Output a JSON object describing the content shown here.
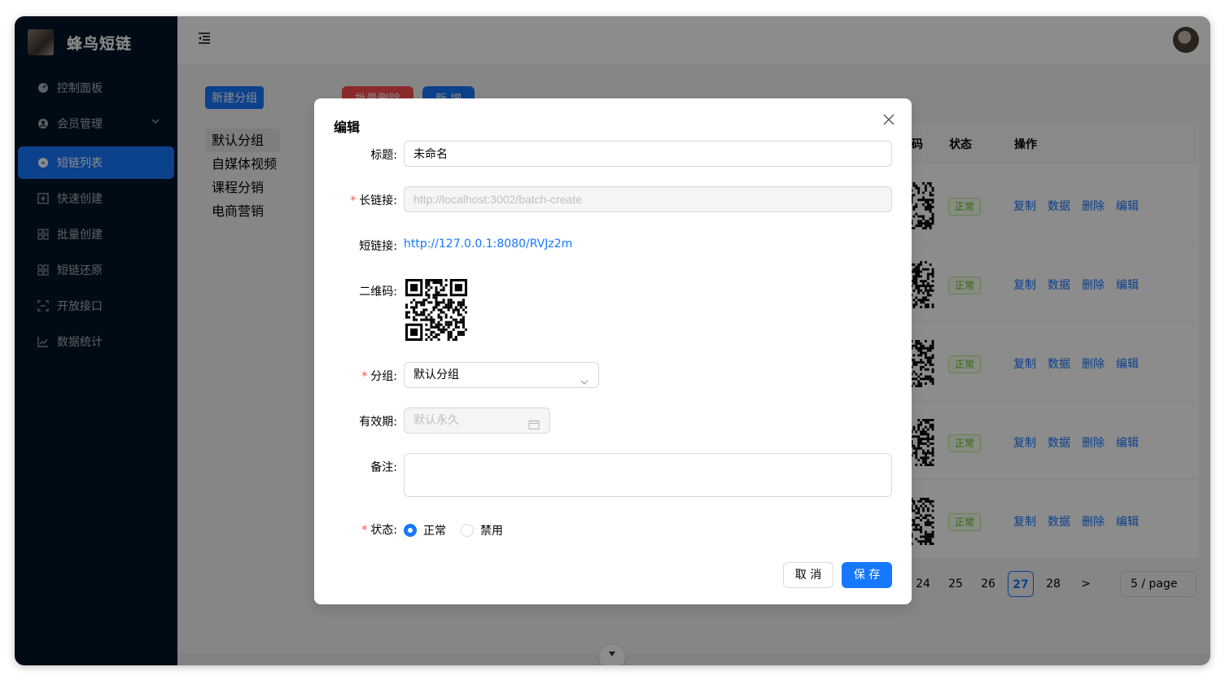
{
  "app": {
    "name": "蜂鸟短链"
  },
  "sidebar": {
    "items": [
      {
        "label": "控制面板",
        "icon": "dashboard-icon"
      },
      {
        "label": "会员管理",
        "icon": "member-icon",
        "has_submenu": true
      },
      {
        "label": "短链列表",
        "icon": "link-icon",
        "active": true
      },
      {
        "label": "快速创建",
        "icon": "plus-square-icon"
      },
      {
        "label": "批量创建",
        "icon": "grid-icon"
      },
      {
        "label": "短链还原",
        "icon": "grid-icon"
      },
      {
        "label": "开放接口",
        "icon": "scan-icon"
      },
      {
        "label": "数据统计",
        "icon": "chart-icon"
      }
    ]
  },
  "groups": {
    "new_button": "新建分组",
    "items": [
      "默认分组",
      "自媒体视频",
      "课程分销",
      "电商营销"
    ]
  },
  "toolbar": {
    "batch_delete": "批量删除",
    "add": "新 增"
  },
  "table": {
    "columns": [
      "码",
      "状态",
      "操作"
    ],
    "rows": [
      {
        "status": "正常",
        "ops": [
          "复制",
          "数据",
          "删除",
          "编辑"
        ]
      },
      {
        "status": "正常",
        "ops": [
          "复制",
          "数据",
          "删除",
          "编辑"
        ]
      },
      {
        "status": "正常",
        "ops": [
          "复制",
          "数据",
          "删除",
          "编辑"
        ]
      },
      {
        "status": "正常",
        "ops": [
          "复制",
          "数据",
          "删除",
          "编辑"
        ]
      },
      {
        "status": "正常",
        "ops": [
          "复制",
          "数据",
          "删除",
          "编辑"
        ]
      }
    ]
  },
  "pagination": {
    "pages": [
      "24",
      "25",
      "26",
      "27",
      "28"
    ],
    "current": "27",
    "next": ">",
    "page_size": "5 / page"
  },
  "modal": {
    "title": "编辑",
    "fields": {
      "title_label": "标题:",
      "title_value": "未命名",
      "long_url_label": "长链接:",
      "long_url_value": "http://localhost:3002/batch-create",
      "short_url_label": "短链接:",
      "short_url_value": "http://127.0.0.1:8080/RVJz2m",
      "qr_label": "二维码:",
      "group_label": "分组:",
      "group_value": "默认分组",
      "expiry_label": "有效期:",
      "expiry_placeholder": "默认永久",
      "note_label": "备注:",
      "note_value": "",
      "status_label": "状态:",
      "status_options": [
        "正常",
        "禁用"
      ],
      "status_selected": "正常"
    },
    "cancel": "取 消",
    "save": "保 存"
  }
}
